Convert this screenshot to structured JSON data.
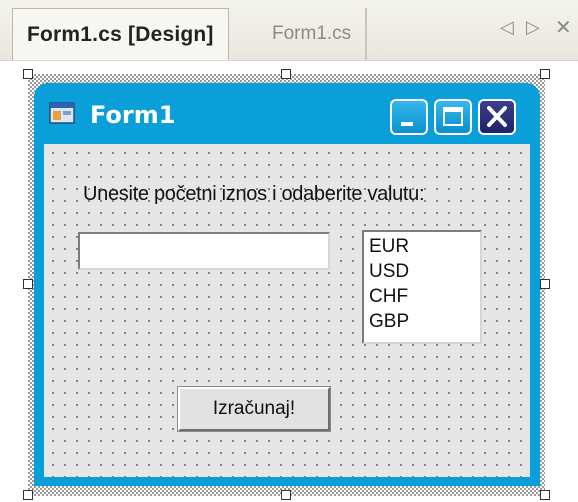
{
  "tabs": [
    {
      "label": "Form1.cs [Design]",
      "active": true
    },
    {
      "label": "Form1.cs",
      "active": false
    }
  ],
  "tab_controls": {
    "prev": "◁",
    "next": "▷",
    "close": "✕"
  },
  "form": {
    "title": "Form1",
    "caption_buttons": [
      "minimize",
      "maximize",
      "close"
    ],
    "prompt_label": "Unesite početni iznos i odaberite valutu:",
    "amount_input": {
      "value": "",
      "placeholder": ""
    },
    "currency_list": [
      "EUR",
      "USD",
      "CHF",
      "GBP"
    ],
    "calc_button_label": "Izračunaj!"
  },
  "colors": {
    "title_bar": "#0a9fd8",
    "client_background": "#e6e6e6",
    "grid_dots": "#6c6c6c"
  }
}
